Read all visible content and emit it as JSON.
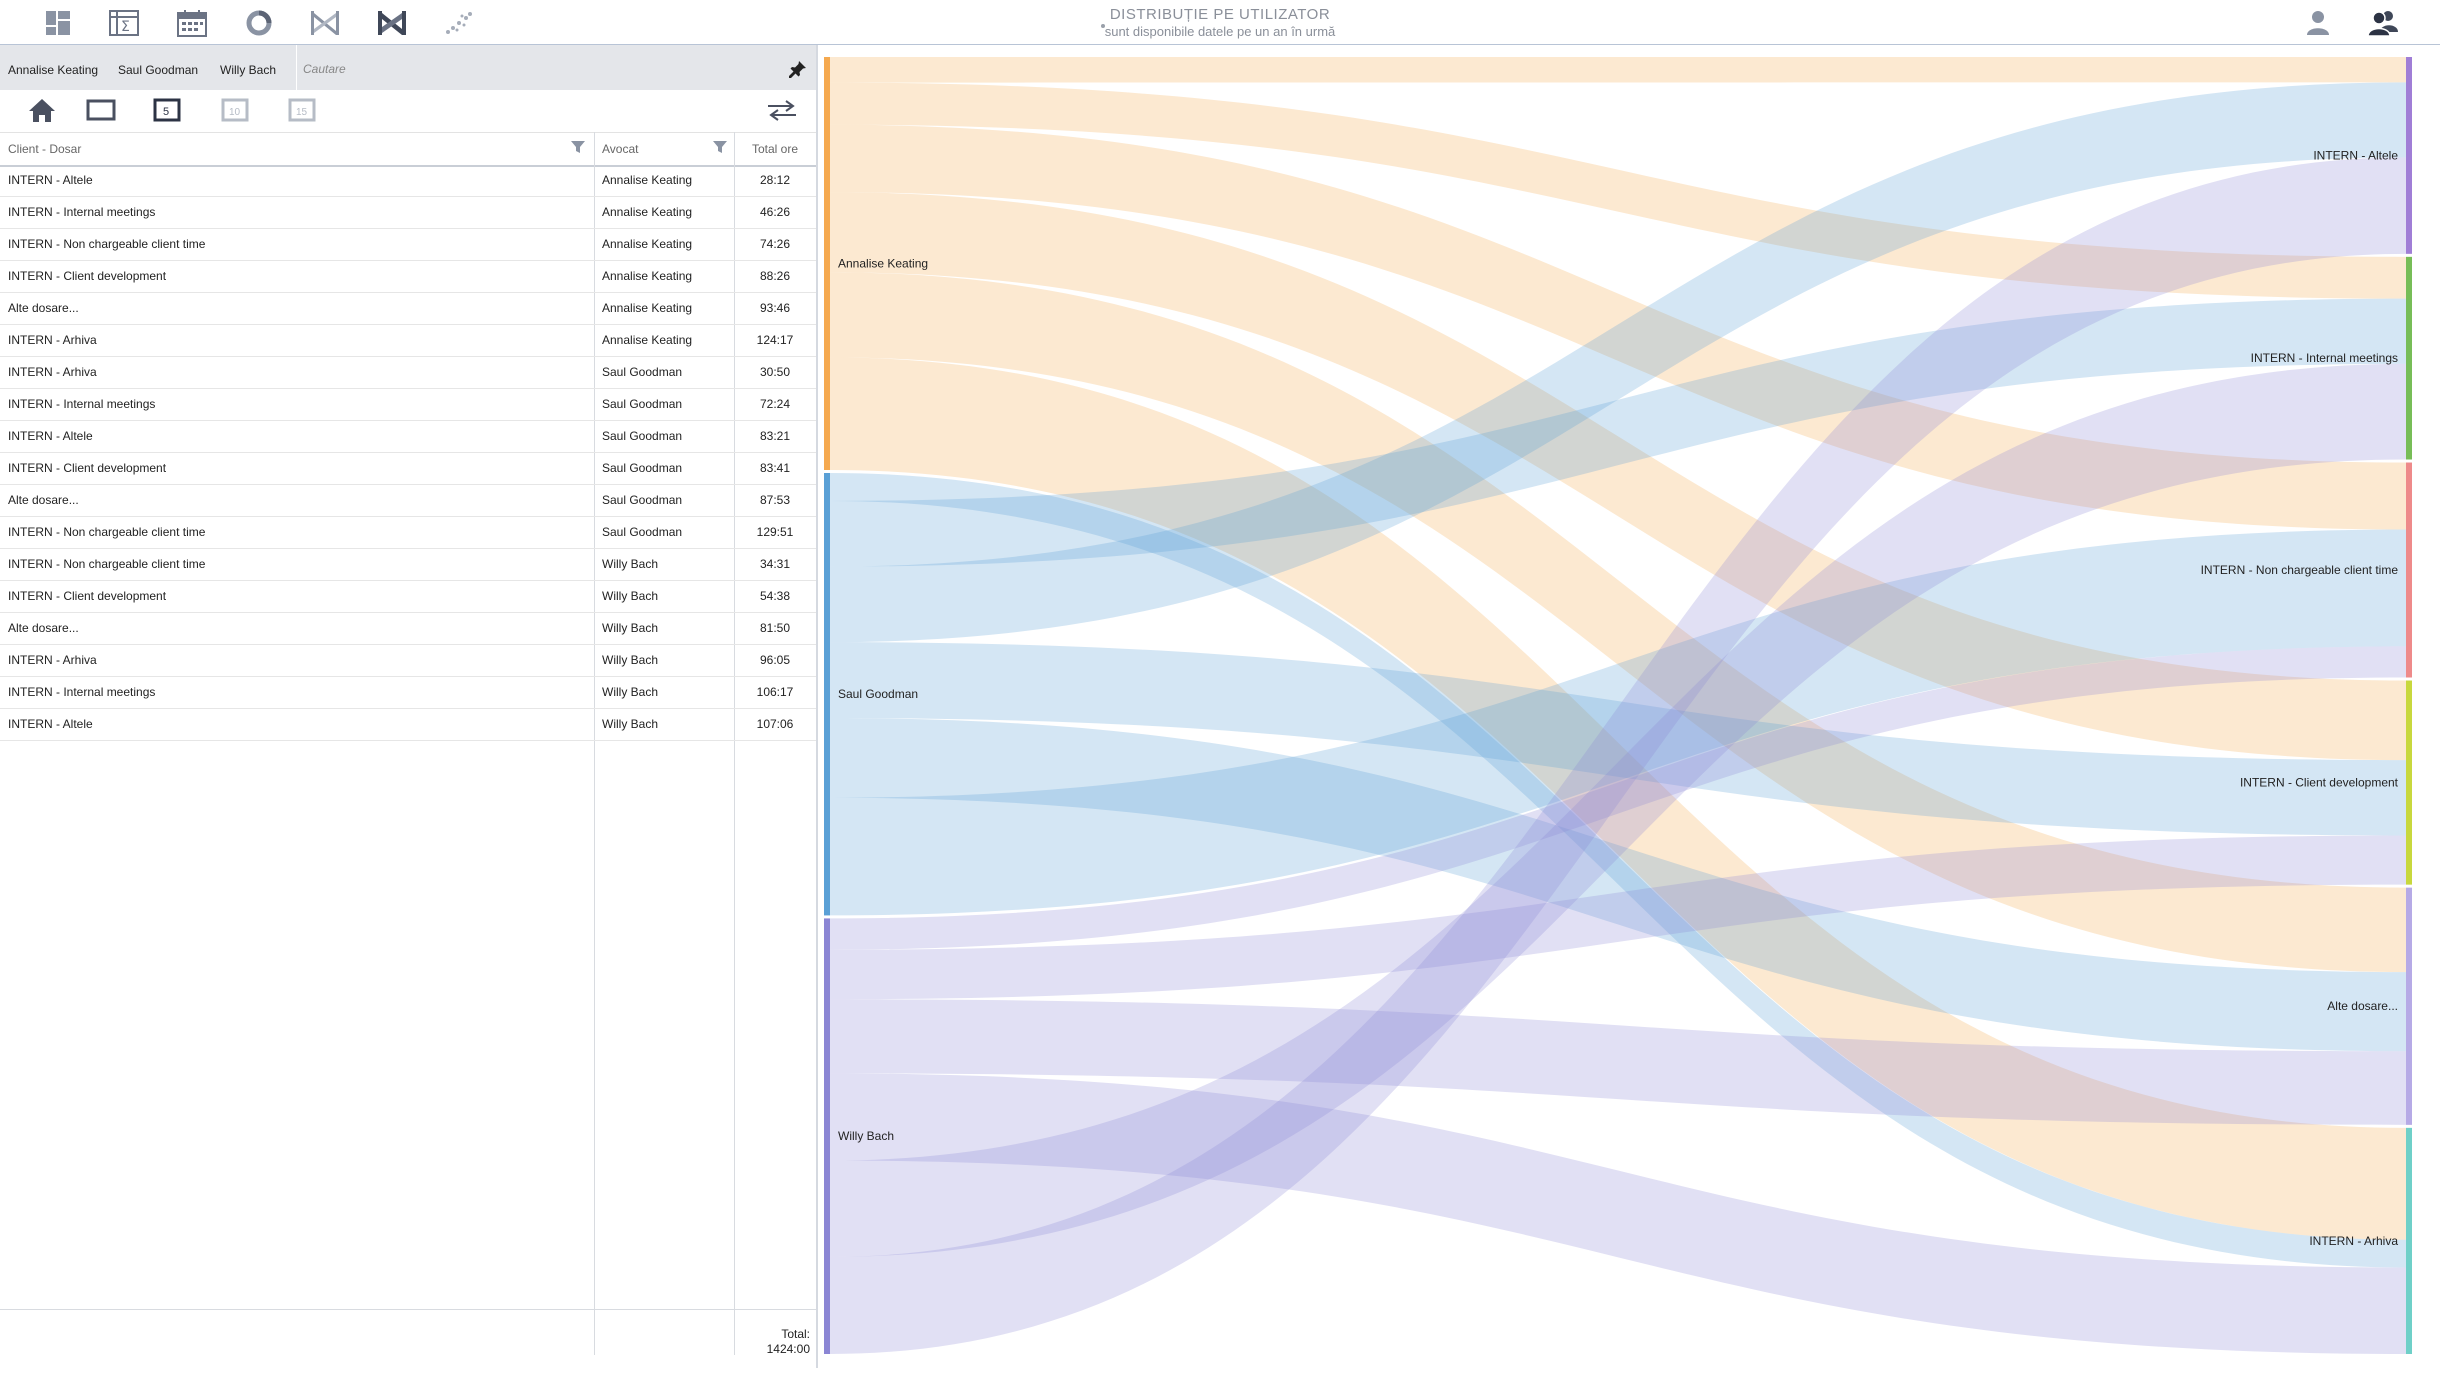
{
  "toolbar": {
    "icons": [
      "dashboard-icon",
      "pivot-table-icon",
      "calendar-icon",
      "donut-chart-icon",
      "chord-diagram-icon",
      "sankey-icon",
      "scatter-icon"
    ],
    "right_icons": [
      "single-user-icon",
      "multi-user-icon"
    ],
    "title": "DISTRIBUȚIE PE UTILIZATOR",
    "subtitle": "sunt disponibile datele pe un an în urmă"
  },
  "filters": {
    "tags": [
      "Annalise Keating",
      "Saul Goodman",
      "Willy Bach"
    ],
    "search_placeholder": "Cautare",
    "pin_icon": "pin-icon"
  },
  "view_icons": [
    "home-icon",
    "single-page-icon",
    "top-5-icon",
    "top-10-icon",
    "top-15-icon",
    "swap-icon"
  ],
  "view_labels": {
    "top5": "5",
    "top10": "10",
    "top15": "15"
  },
  "table": {
    "columns": [
      "Client - Dosar",
      "Avocat",
      "Total ore"
    ],
    "rows": [
      {
        "client": "INTERN - Altele",
        "lawyer": "Annalise Keating",
        "hours": "28:12"
      },
      {
        "client": "INTERN - Internal meetings",
        "lawyer": "Annalise Keating",
        "hours": "46:26"
      },
      {
        "client": "INTERN - Non chargeable client time",
        "lawyer": "Annalise Keating",
        "hours": "74:26"
      },
      {
        "client": "INTERN - Client development",
        "lawyer": "Annalise Keating",
        "hours": "88:26"
      },
      {
        "client": "Alte dosare...",
        "lawyer": "Annalise Keating",
        "hours": "93:46"
      },
      {
        "client": "INTERN - Arhiva",
        "lawyer": "Annalise Keating",
        "hours": "124:17"
      },
      {
        "client": "INTERN - Arhiva",
        "lawyer": "Saul Goodman",
        "hours": "30:50"
      },
      {
        "client": "INTERN - Internal meetings",
        "lawyer": "Saul Goodman",
        "hours": "72:24"
      },
      {
        "client": "INTERN - Altele",
        "lawyer": "Saul Goodman",
        "hours": "83:21"
      },
      {
        "client": "INTERN - Client development",
        "lawyer": "Saul Goodman",
        "hours": "83:41"
      },
      {
        "client": "Alte dosare...",
        "lawyer": "Saul Goodman",
        "hours": "87:53"
      },
      {
        "client": "INTERN - Non chargeable client time",
        "lawyer": "Saul Goodman",
        "hours": "129:51"
      },
      {
        "client": "INTERN - Non chargeable client time",
        "lawyer": "Willy Bach",
        "hours": "34:31"
      },
      {
        "client": "INTERN - Client development",
        "lawyer": "Willy Bach",
        "hours": "54:38"
      },
      {
        "client": "Alte dosare...",
        "lawyer": "Willy Bach",
        "hours": "81:50"
      },
      {
        "client": "INTERN - Arhiva",
        "lawyer": "Willy Bach",
        "hours": "96:05"
      },
      {
        "client": "INTERN - Internal meetings",
        "lawyer": "Willy Bach",
        "hours": "106:17"
      },
      {
        "client": "INTERN - Altele",
        "lawyer": "Willy Bach",
        "hours": "107:06"
      }
    ],
    "total_label": "Total:",
    "total_value": "1424:00"
  },
  "chart_data": {
    "type": "sankey",
    "sources": [
      {
        "name": "Annalise Keating",
        "color": "#f5a94f"
      },
      {
        "name": "Saul Goodman",
        "color": "#5aa0d6"
      },
      {
        "name": "Willy Bach",
        "color": "#8b86d4"
      }
    ],
    "targets": [
      {
        "name": "INTERN - Altele",
        "color": "#a07ed6"
      },
      {
        "name": "INTERN - Internal meetings",
        "color": "#77bd57"
      },
      {
        "name": "INTERN - Non chargeable client time",
        "color": "#ee8a8a"
      },
      {
        "name": "INTERN - Client development",
        "color": "#c8d83d"
      },
      {
        "name": "Alte dosare...",
        "color": "#b6aae6"
      },
      {
        "name": "INTERN - Arhiva",
        "color": "#6fd0c8"
      }
    ],
    "flows": [
      {
        "source": "Annalise Keating",
        "target": "INTERN - Altele",
        "hours": 28.2
      },
      {
        "source": "Annalise Keating",
        "target": "INTERN - Internal meetings",
        "hours": 46.43
      },
      {
        "source": "Annalise Keating",
        "target": "INTERN - Non chargeable client time",
        "hours": 74.43
      },
      {
        "source": "Annalise Keating",
        "target": "INTERN - Client development",
        "hours": 88.43
      },
      {
        "source": "Annalise Keating",
        "target": "Alte dosare...",
        "hours": 93.77
      },
      {
        "source": "Annalise Keating",
        "target": "INTERN - Arhiva",
        "hours": 124.28
      },
      {
        "source": "Saul Goodman",
        "target": "INTERN - Arhiva",
        "hours": 30.83
      },
      {
        "source": "Saul Goodman",
        "target": "INTERN - Internal meetings",
        "hours": 72.4
      },
      {
        "source": "Saul Goodman",
        "target": "INTERN - Altele",
        "hours": 83.35
      },
      {
        "source": "Saul Goodman",
        "target": "INTERN - Client development",
        "hours": 83.68
      },
      {
        "source": "Saul Goodman",
        "target": "Alte dosare...",
        "hours": 87.88
      },
      {
        "source": "Saul Goodman",
        "target": "INTERN - Non chargeable client time",
        "hours": 129.85
      },
      {
        "source": "Willy Bach",
        "target": "INTERN - Non chargeable client time",
        "hours": 34.52
      },
      {
        "source": "Willy Bach",
        "target": "INTERN - Client development",
        "hours": 54.63
      },
      {
        "source": "Willy Bach",
        "target": "Alte dosare...",
        "hours": 81.83
      },
      {
        "source": "Willy Bach",
        "target": "INTERN - Arhiva",
        "hours": 96.08
      },
      {
        "source": "Willy Bach",
        "target": "INTERN - Internal meetings",
        "hours": 106.28
      },
      {
        "source": "Willy Bach",
        "target": "INTERN - Altele",
        "hours": 107.1
      }
    ]
  }
}
